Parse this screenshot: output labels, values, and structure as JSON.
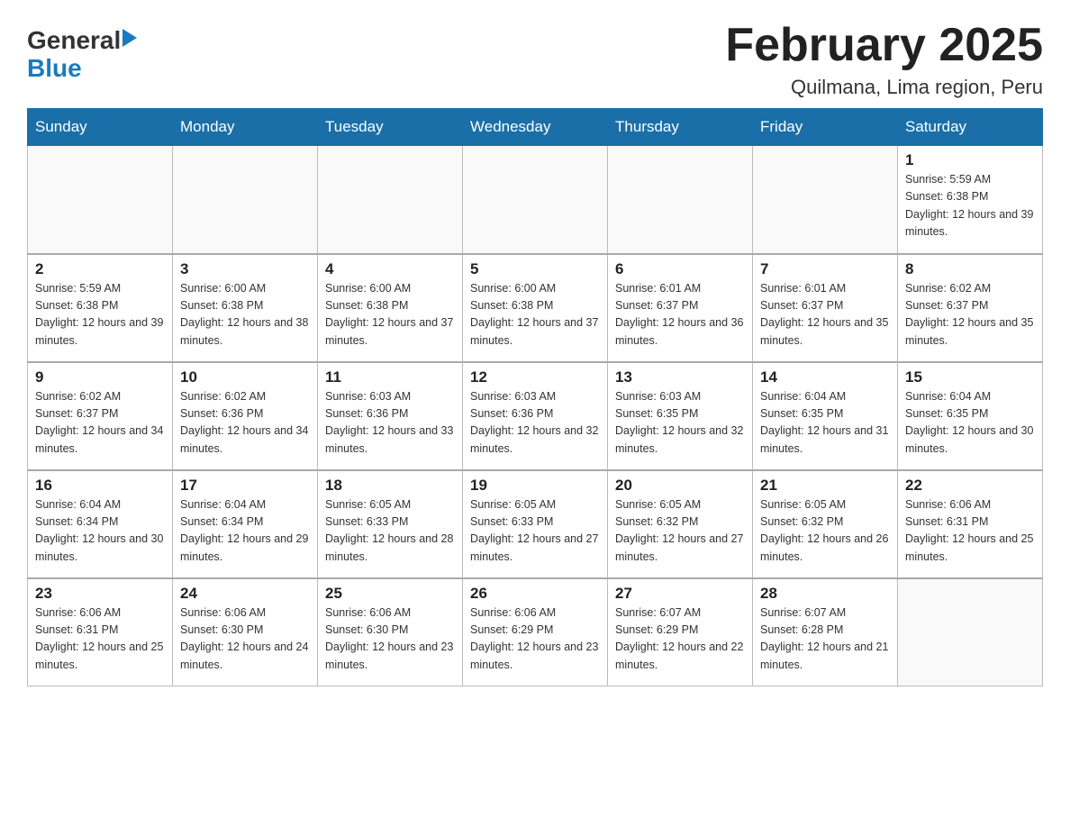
{
  "header": {
    "logo": {
      "general": "General",
      "blue": "Blue"
    },
    "title": "February 2025",
    "location": "Quilmana, Lima region, Peru"
  },
  "days_of_week": [
    "Sunday",
    "Monday",
    "Tuesday",
    "Wednesday",
    "Thursday",
    "Friday",
    "Saturday"
  ],
  "weeks": [
    [
      {
        "day": "",
        "sunrise": "",
        "sunset": "",
        "daylight": ""
      },
      {
        "day": "",
        "sunrise": "",
        "sunset": "",
        "daylight": ""
      },
      {
        "day": "",
        "sunrise": "",
        "sunset": "",
        "daylight": ""
      },
      {
        "day": "",
        "sunrise": "",
        "sunset": "",
        "daylight": ""
      },
      {
        "day": "",
        "sunrise": "",
        "sunset": "",
        "daylight": ""
      },
      {
        "day": "",
        "sunrise": "",
        "sunset": "",
        "daylight": ""
      },
      {
        "day": "1",
        "sunrise": "Sunrise: 5:59 AM",
        "sunset": "Sunset: 6:38 PM",
        "daylight": "Daylight: 12 hours and 39 minutes."
      }
    ],
    [
      {
        "day": "2",
        "sunrise": "Sunrise: 5:59 AM",
        "sunset": "Sunset: 6:38 PM",
        "daylight": "Daylight: 12 hours and 39 minutes."
      },
      {
        "day": "3",
        "sunrise": "Sunrise: 6:00 AM",
        "sunset": "Sunset: 6:38 PM",
        "daylight": "Daylight: 12 hours and 38 minutes."
      },
      {
        "day": "4",
        "sunrise": "Sunrise: 6:00 AM",
        "sunset": "Sunset: 6:38 PM",
        "daylight": "Daylight: 12 hours and 37 minutes."
      },
      {
        "day": "5",
        "sunrise": "Sunrise: 6:00 AM",
        "sunset": "Sunset: 6:38 PM",
        "daylight": "Daylight: 12 hours and 37 minutes."
      },
      {
        "day": "6",
        "sunrise": "Sunrise: 6:01 AM",
        "sunset": "Sunset: 6:37 PM",
        "daylight": "Daylight: 12 hours and 36 minutes."
      },
      {
        "day": "7",
        "sunrise": "Sunrise: 6:01 AM",
        "sunset": "Sunset: 6:37 PM",
        "daylight": "Daylight: 12 hours and 35 minutes."
      },
      {
        "day": "8",
        "sunrise": "Sunrise: 6:02 AM",
        "sunset": "Sunset: 6:37 PM",
        "daylight": "Daylight: 12 hours and 35 minutes."
      }
    ],
    [
      {
        "day": "9",
        "sunrise": "Sunrise: 6:02 AM",
        "sunset": "Sunset: 6:37 PM",
        "daylight": "Daylight: 12 hours and 34 minutes."
      },
      {
        "day": "10",
        "sunrise": "Sunrise: 6:02 AM",
        "sunset": "Sunset: 6:36 PM",
        "daylight": "Daylight: 12 hours and 34 minutes."
      },
      {
        "day": "11",
        "sunrise": "Sunrise: 6:03 AM",
        "sunset": "Sunset: 6:36 PM",
        "daylight": "Daylight: 12 hours and 33 minutes."
      },
      {
        "day": "12",
        "sunrise": "Sunrise: 6:03 AM",
        "sunset": "Sunset: 6:36 PM",
        "daylight": "Daylight: 12 hours and 32 minutes."
      },
      {
        "day": "13",
        "sunrise": "Sunrise: 6:03 AM",
        "sunset": "Sunset: 6:35 PM",
        "daylight": "Daylight: 12 hours and 32 minutes."
      },
      {
        "day": "14",
        "sunrise": "Sunrise: 6:04 AM",
        "sunset": "Sunset: 6:35 PM",
        "daylight": "Daylight: 12 hours and 31 minutes."
      },
      {
        "day": "15",
        "sunrise": "Sunrise: 6:04 AM",
        "sunset": "Sunset: 6:35 PM",
        "daylight": "Daylight: 12 hours and 30 minutes."
      }
    ],
    [
      {
        "day": "16",
        "sunrise": "Sunrise: 6:04 AM",
        "sunset": "Sunset: 6:34 PM",
        "daylight": "Daylight: 12 hours and 30 minutes."
      },
      {
        "day": "17",
        "sunrise": "Sunrise: 6:04 AM",
        "sunset": "Sunset: 6:34 PM",
        "daylight": "Daylight: 12 hours and 29 minutes."
      },
      {
        "day": "18",
        "sunrise": "Sunrise: 6:05 AM",
        "sunset": "Sunset: 6:33 PM",
        "daylight": "Daylight: 12 hours and 28 minutes."
      },
      {
        "day": "19",
        "sunrise": "Sunrise: 6:05 AM",
        "sunset": "Sunset: 6:33 PM",
        "daylight": "Daylight: 12 hours and 27 minutes."
      },
      {
        "day": "20",
        "sunrise": "Sunrise: 6:05 AM",
        "sunset": "Sunset: 6:32 PM",
        "daylight": "Daylight: 12 hours and 27 minutes."
      },
      {
        "day": "21",
        "sunrise": "Sunrise: 6:05 AM",
        "sunset": "Sunset: 6:32 PM",
        "daylight": "Daylight: 12 hours and 26 minutes."
      },
      {
        "day": "22",
        "sunrise": "Sunrise: 6:06 AM",
        "sunset": "Sunset: 6:31 PM",
        "daylight": "Daylight: 12 hours and 25 minutes."
      }
    ],
    [
      {
        "day": "23",
        "sunrise": "Sunrise: 6:06 AM",
        "sunset": "Sunset: 6:31 PM",
        "daylight": "Daylight: 12 hours and 25 minutes."
      },
      {
        "day": "24",
        "sunrise": "Sunrise: 6:06 AM",
        "sunset": "Sunset: 6:30 PM",
        "daylight": "Daylight: 12 hours and 24 minutes."
      },
      {
        "day": "25",
        "sunrise": "Sunrise: 6:06 AM",
        "sunset": "Sunset: 6:30 PM",
        "daylight": "Daylight: 12 hours and 23 minutes."
      },
      {
        "day": "26",
        "sunrise": "Sunrise: 6:06 AM",
        "sunset": "Sunset: 6:29 PM",
        "daylight": "Daylight: 12 hours and 23 minutes."
      },
      {
        "day": "27",
        "sunrise": "Sunrise: 6:07 AM",
        "sunset": "Sunset: 6:29 PM",
        "daylight": "Daylight: 12 hours and 22 minutes."
      },
      {
        "day": "28",
        "sunrise": "Sunrise: 6:07 AM",
        "sunset": "Sunset: 6:28 PM",
        "daylight": "Daylight: 12 hours and 21 minutes."
      },
      {
        "day": "",
        "sunrise": "",
        "sunset": "",
        "daylight": ""
      }
    ]
  ]
}
